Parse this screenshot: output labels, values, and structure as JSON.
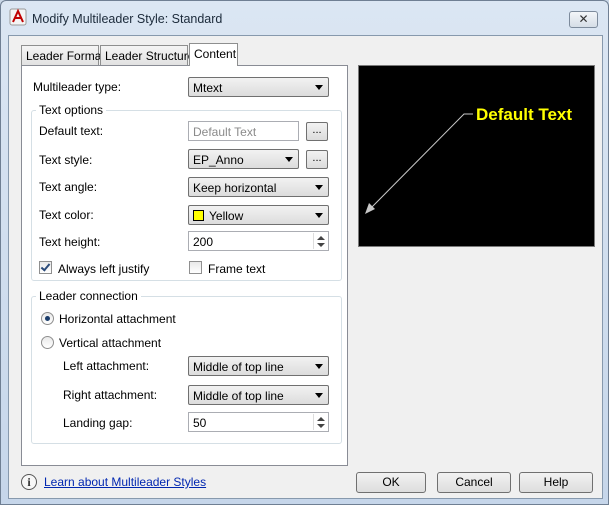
{
  "window": {
    "title": "Modify Multileader Style: Standard",
    "close_glyph": "✕",
    "app_icon": "autocad-a-icon"
  },
  "tabs": [
    {
      "label": "Leader Format",
      "active": false
    },
    {
      "label": "Leader Structure",
      "active": false
    },
    {
      "label": "Content",
      "active": true
    }
  ],
  "content": {
    "multileader_type_label": "Multileader type:",
    "multileader_type_value": "Mtext",
    "text_options": {
      "title": "Text options",
      "default_text_label": "Default text:",
      "default_text_value": "Default Text",
      "browse_label": "...",
      "text_style_label": "Text style:",
      "text_style_value": "EP_Anno",
      "text_angle_label": "Text angle:",
      "text_angle_value": "Keep horizontal",
      "text_color_label": "Text color:",
      "text_color_value": "Yellow",
      "text_color_hex": "#ffff00",
      "text_height_label": "Text height:",
      "text_height_value": "200",
      "always_left_justify_label": "Always left justify",
      "always_left_justify_checked": true,
      "frame_text_label": "Frame text",
      "frame_text_checked": false
    },
    "leader_connection": {
      "title": "Leader connection",
      "horizontal_label": "Horizontal attachment",
      "vertical_label": "Vertical attachment",
      "selected": "horizontal",
      "left_attachment_label": "Left attachment:",
      "left_attachment_value": "Middle of top line",
      "right_attachment_label": "Right attachment:",
      "right_attachment_value": "Middle of top line",
      "landing_gap_label": "Landing gap:",
      "landing_gap_value": "50"
    }
  },
  "preview": {
    "text": "Default Text",
    "text_color": "#ffff00",
    "leader_color": "#c8c8c8",
    "background": "#000000"
  },
  "footer": {
    "help_link": "Learn about Multileader Styles",
    "ok_label": "OK",
    "cancel_label": "Cancel",
    "help_label": "Help"
  }
}
